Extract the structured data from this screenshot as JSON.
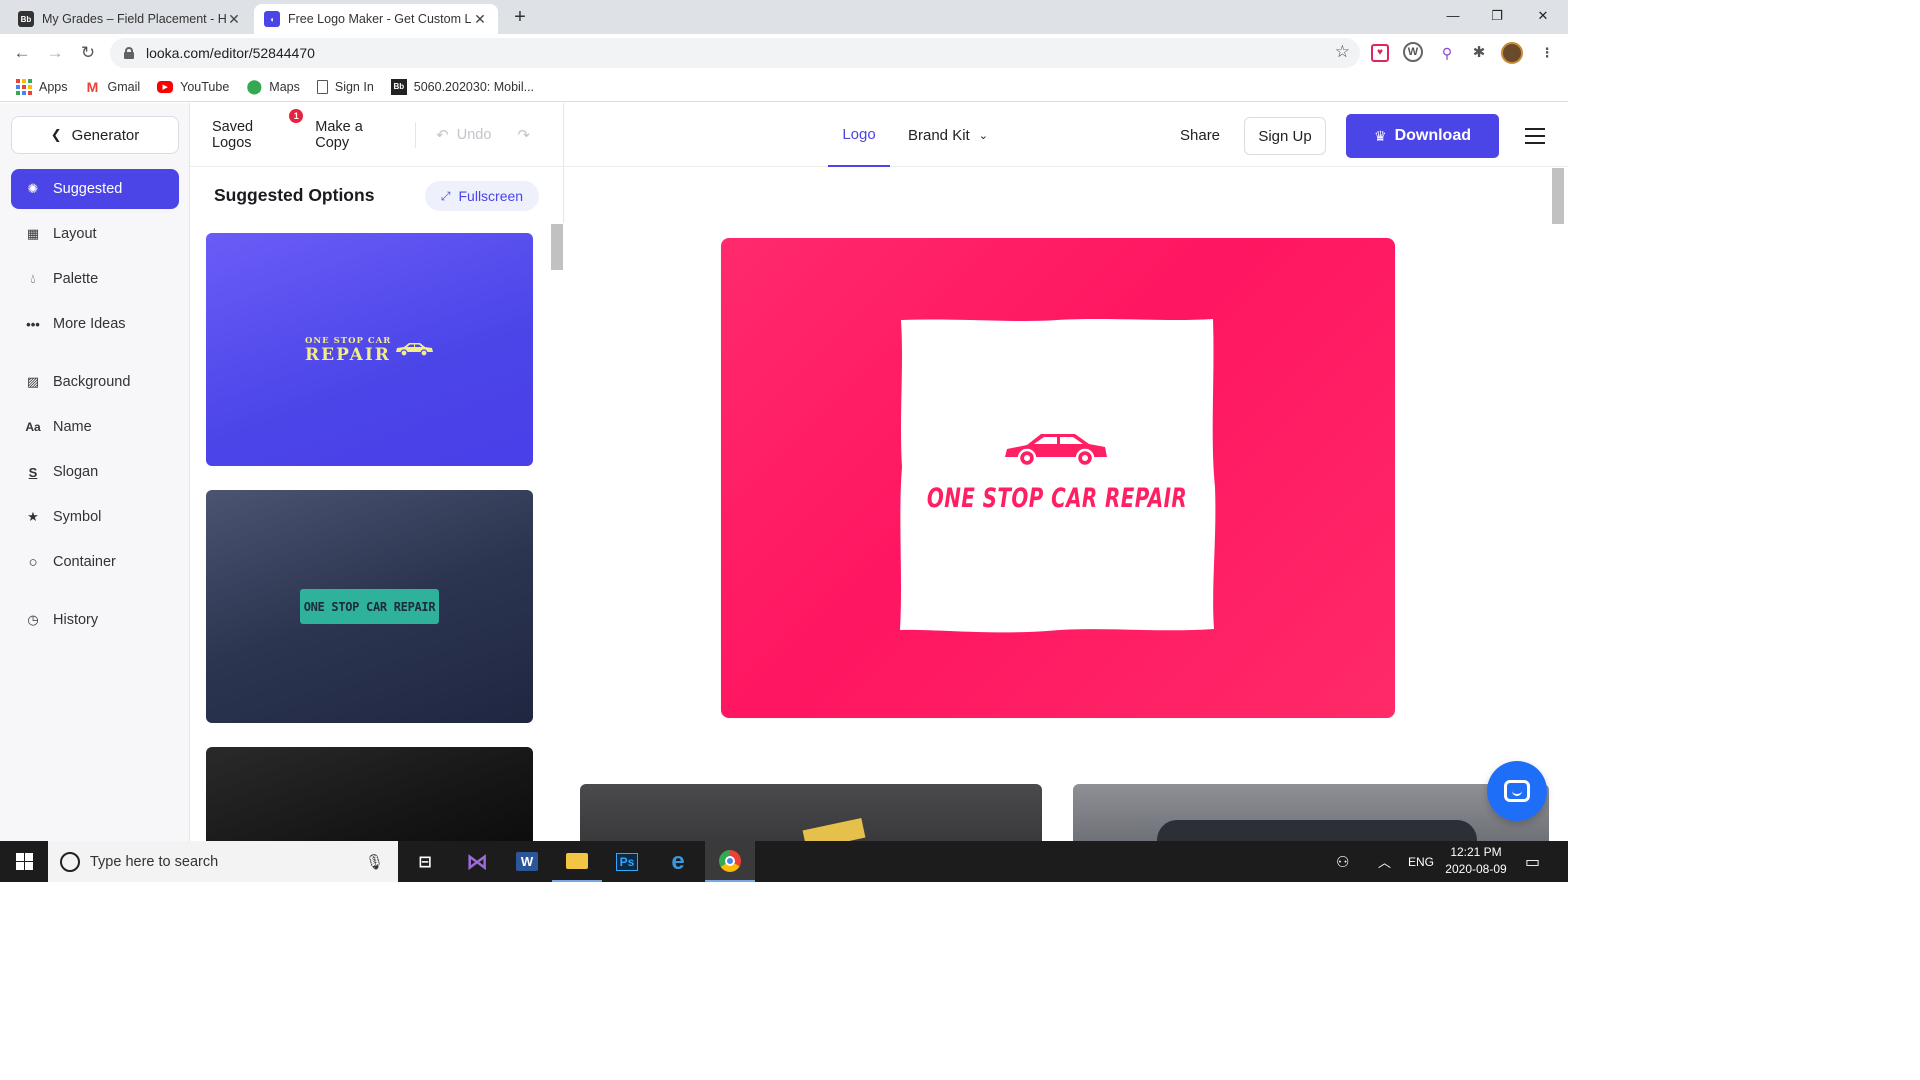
{
  "browser": {
    "tabs": [
      {
        "title": "My Grades – Field Placement - H",
        "favicon": "Bb",
        "active": false
      },
      {
        "title": "Free Logo Maker - Get Custom L",
        "favicon": "looka",
        "active": true
      }
    ],
    "url": "looka.com/editor/52844470",
    "bookmarks": [
      {
        "label": "Apps",
        "icon": "apps-grid-icon"
      },
      {
        "label": "Gmail",
        "icon": "gmail-icon"
      },
      {
        "label": "YouTube",
        "icon": "youtube-icon"
      },
      {
        "label": "Maps",
        "icon": "maps-pin-icon"
      },
      {
        "label": "Sign In",
        "icon": "page-icon"
      },
      {
        "label": "5060.202030: Mobil...",
        "icon": "blackboard-icon"
      }
    ]
  },
  "sidebar": {
    "generator_label": "Generator",
    "items": [
      {
        "label": "Suggested",
        "icon": "bulb-icon"
      },
      {
        "label": "Layout",
        "icon": "layout-icon"
      },
      {
        "label": "Palette",
        "icon": "drop-icon"
      },
      {
        "label": "More Ideas",
        "icon": "dots-icon"
      },
      {
        "label": "Background",
        "icon": "hatch-icon"
      },
      {
        "label": "Name",
        "icon": "font-icon"
      },
      {
        "label": "Slogan",
        "icon": "slogan-icon"
      },
      {
        "label": "Symbol",
        "icon": "star-icon"
      },
      {
        "label": "Container",
        "icon": "circle-icon"
      },
      {
        "label": "History",
        "icon": "clock-icon"
      }
    ]
  },
  "toolbar": {
    "saved_logos": "Saved Logos",
    "saved_badge": "1",
    "make_copy": "Make a Copy",
    "undo": "Undo"
  },
  "options": {
    "title": "Suggested Options",
    "fullscreen": "Fullscreen",
    "card1": {
      "line1": "ONE STOP CAR",
      "line2": "REPAIR"
    },
    "card2": {
      "text": "ONE STOP CAR REPAIR"
    }
  },
  "topnav": {
    "logo_tab": "Logo",
    "brand_kit": "Brand Kit",
    "share": "Share",
    "sign_up": "Sign Up",
    "download": "Download"
  },
  "preview": {
    "brand_name": "ONE STOP CAR REPAIR",
    "colors": {
      "background": "#ff1f62",
      "accent": "#4b45e8",
      "frame": "#ffffff"
    }
  },
  "taskbar": {
    "search_placeholder": "Type here to search",
    "language": "ENG",
    "time": "12:21 PM",
    "date": "2020-08-09"
  }
}
